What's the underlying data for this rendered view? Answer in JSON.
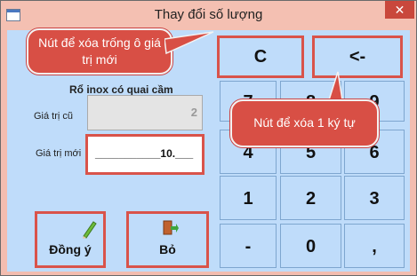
{
  "window": {
    "title": "Thay đổi số lượng",
    "close_glyph": "✕"
  },
  "product_name": "Rổ inox có quai cầm",
  "old_value": {
    "label": "Giá trị cũ",
    "value": "2"
  },
  "new_value": {
    "label": "Giá trị mới",
    "value": "___________10.___"
  },
  "keypad": {
    "clear": "C",
    "backspace": "<-",
    "keys": [
      "7",
      "8",
      "9",
      "4",
      "5",
      "6",
      "1",
      "2",
      "3",
      "-",
      "0",
      ","
    ]
  },
  "actions": {
    "ok": "Đồng ý",
    "cancel": "Bỏ"
  },
  "icons": {
    "ok": "pencil-icon",
    "cancel": "exit-door-icon"
  },
  "callouts": {
    "clear": "Nút để xóa trống ô giá trị mới",
    "backspace": "Nút để xóa 1 ký tự"
  },
  "colors": {
    "callout": "#d84f45",
    "highlight_border": "#d9534a",
    "panel": "#bfdcfa",
    "titlebar": "#f4c0b2"
  }
}
